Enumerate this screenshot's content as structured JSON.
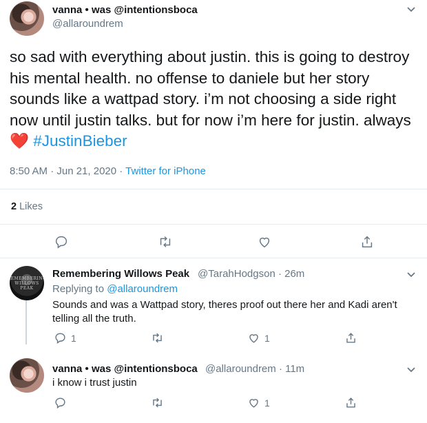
{
  "tweet": {
    "display_name": "vanna • was @intentionsboca",
    "handle": "@allaroundrem",
    "text_before_tag": "so sad with everything about justin. this is going to destroy his mental health. no offense to daniele but her story sounds like a wattpad story. i’m not choosing a side right now until justin talks. but for now i’m here for justin. always ",
    "heart_emoji": "❤️",
    "hashtag": "#JustinBieber",
    "timestamp": "8:50 AM · Jun 21, 2020 · ",
    "source": "Twitter for iPhone",
    "likes_count": "2",
    "likes_label": " Likes"
  },
  "replies": [
    {
      "avatar_text": "REMEMBERING WILLOWS PEAK",
      "display_name": "Remembering Willows Peak",
      "handle_time": "@TarahHodgson · 26m",
      "replying_to_label": "Replying to ",
      "replying_to_handle": "@allaroundrem",
      "text": "Sounds and was a Wattpad story, theres proof out there her and Kadi aren't telling all the truth.",
      "reply_count": "1",
      "like_count": "1"
    },
    {
      "display_name": "vanna • was @intentionsboca",
      "handle_time": "@allaroundrem · 11m",
      "text": "i know i trust justin",
      "reply_count": "",
      "like_count": "1"
    }
  ],
  "icons": {
    "menu": "chevron-down-icon",
    "reply": "reply-icon",
    "retweet": "retweet-icon",
    "like": "heart-icon",
    "share": "share-icon"
  },
  "colors": {
    "link": "#1b95e0",
    "secondary": "#657786",
    "divider": "#e6ecf0",
    "heart": "#e0245e"
  }
}
